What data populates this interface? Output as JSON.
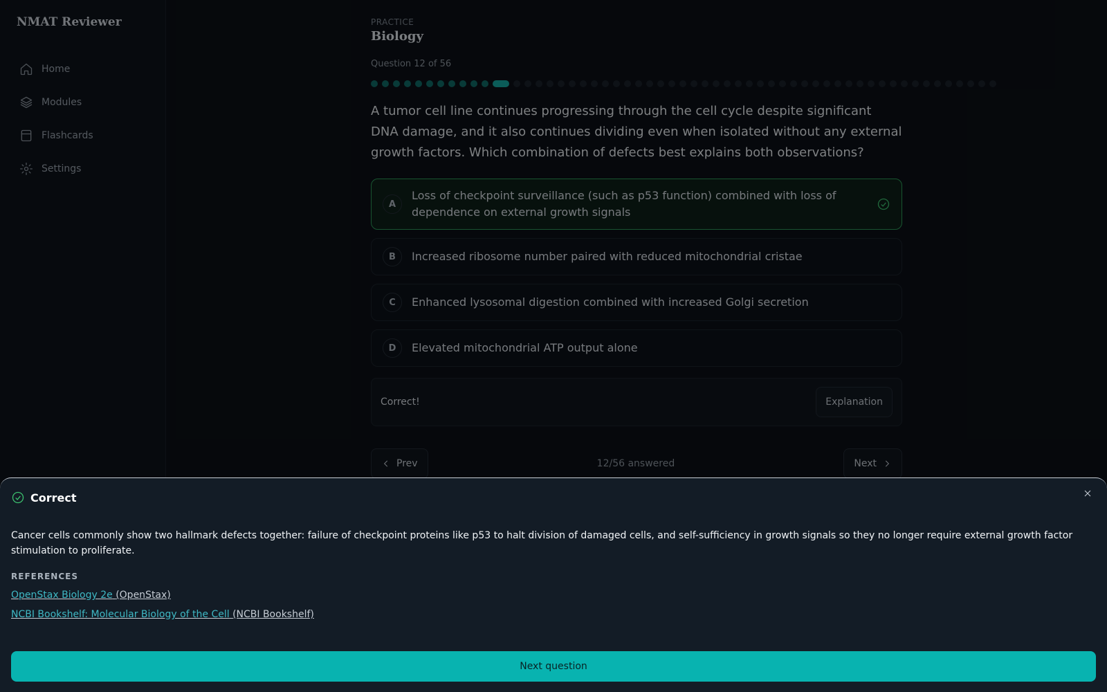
{
  "app": {
    "brand": "NMAT Reviewer"
  },
  "sidebar": {
    "items": [
      {
        "label": "Home",
        "icon": "home-icon"
      },
      {
        "label": "Modules",
        "icon": "layers-icon"
      },
      {
        "label": "Flashcards",
        "icon": "card-icon"
      },
      {
        "label": "Settings",
        "icon": "gear-icon"
      }
    ]
  },
  "main": {
    "kicker": "PRACTICE",
    "subject": "Biology",
    "question_counter": "Question 12 of 56",
    "progress": {
      "current": 12,
      "total": 56
    },
    "question": "A tumor cell line continues progressing through the cell cycle despite significant DNA damage, and it also continues dividing even when isolated without any external growth factors. Which combination of defects best explains both observations?",
    "options": [
      {
        "letter": "A",
        "text": "Loss of checkpoint surveillance (such as p53 function) combined with loss of dependence on external growth signals",
        "correct": true
      },
      {
        "letter": "B",
        "text": "Increased ribosome number paired with reduced mitochondrial cristae"
      },
      {
        "letter": "C",
        "text": "Enhanced lysosomal digestion combined with increased Golgi secretion"
      },
      {
        "letter": "D",
        "text": "Elevated mitochondrial ATP output alone"
      }
    ],
    "feedback": "Correct!",
    "explanation_label": "Explanation",
    "prev_label": "Prev",
    "next_label": "Next",
    "answered": "12/56 answered"
  },
  "sheet": {
    "title": "Correct",
    "body": "Cancer cells commonly show two hallmark defects together: failure of checkpoint proteins like p53 to halt division of damaged cells, and self-sufficiency in growth signals so they no longer require external growth factor stimulation to proliferate.",
    "references_heading": "REFERENCES",
    "references": [
      {
        "title": "OpenStax Biology 2e",
        "source": "(OpenStax)"
      },
      {
        "title": "NCBI Bookshelf: Molecular Biology of the Cell",
        "source": "(NCBI Bookshelf)"
      }
    ],
    "next_question_label": "Next question"
  },
  "colors": {
    "accent": "#08b3b0",
    "success": "#3cbf6e",
    "link": "#3fb8c4"
  }
}
